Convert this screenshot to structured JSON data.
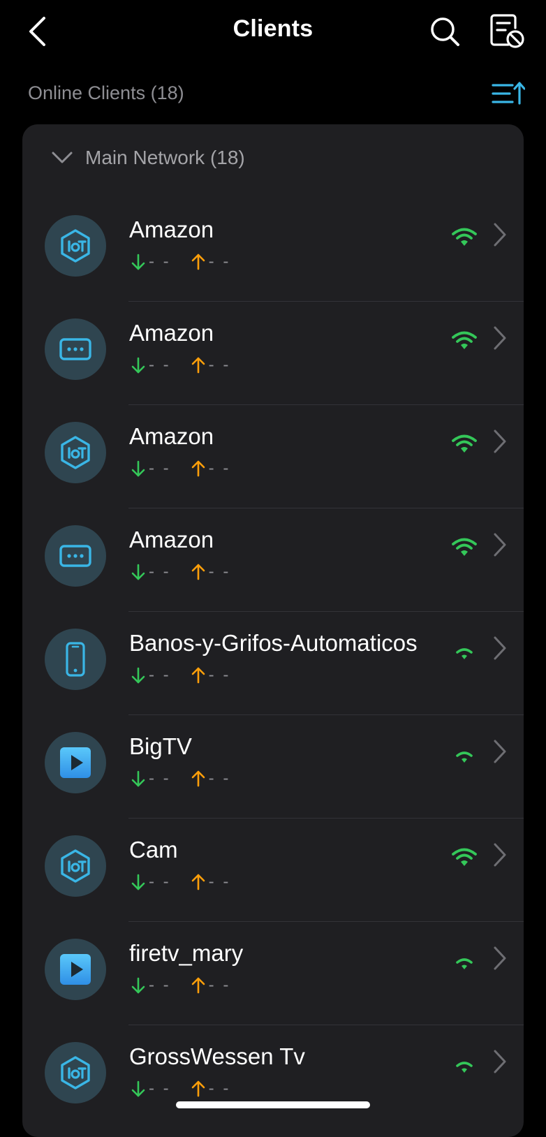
{
  "header": {
    "title": "Clients"
  },
  "subheader": {
    "online_label": "Online Clients (18)"
  },
  "group": {
    "label": "Main Network (18)"
  },
  "colors": {
    "accent": "#3ab6e6",
    "download": "#34c759",
    "upload": "#ff9f0a",
    "signal": "#34c759"
  },
  "clients": [
    {
      "name": "Amazon",
      "icon": "iot-hexagon-icon",
      "download": "- -",
      "upload": "- -",
      "signal": "strong"
    },
    {
      "name": "Amazon",
      "icon": "generic-device-icon",
      "download": "- -",
      "upload": "- -",
      "signal": "strong"
    },
    {
      "name": "Amazon",
      "icon": "iot-hexagon-icon",
      "download": "- -",
      "upload": "- -",
      "signal": "strong"
    },
    {
      "name": "Amazon",
      "icon": "generic-device-icon",
      "download": "- -",
      "upload": "- -",
      "signal": "strong"
    },
    {
      "name": "Banos-y-Grifos-Automaticos",
      "icon": "phone-icon",
      "download": "- -",
      "upload": "- -",
      "signal": "weak"
    },
    {
      "name": "BigTV",
      "icon": "tv-play-icon",
      "download": "- -",
      "upload": "- -",
      "signal": "weak"
    },
    {
      "name": "Cam",
      "icon": "iot-hexagon-icon",
      "download": "- -",
      "upload": "- -",
      "signal": "strong"
    },
    {
      "name": "firetv_mary",
      "icon": "tv-play-icon",
      "download": "- -",
      "upload": "- -",
      "signal": "weak"
    },
    {
      "name": "GrossWessen Tv",
      "icon": "iot-hexagon-icon",
      "download": "- -",
      "upload": "- -",
      "signal": "weak"
    }
  ]
}
